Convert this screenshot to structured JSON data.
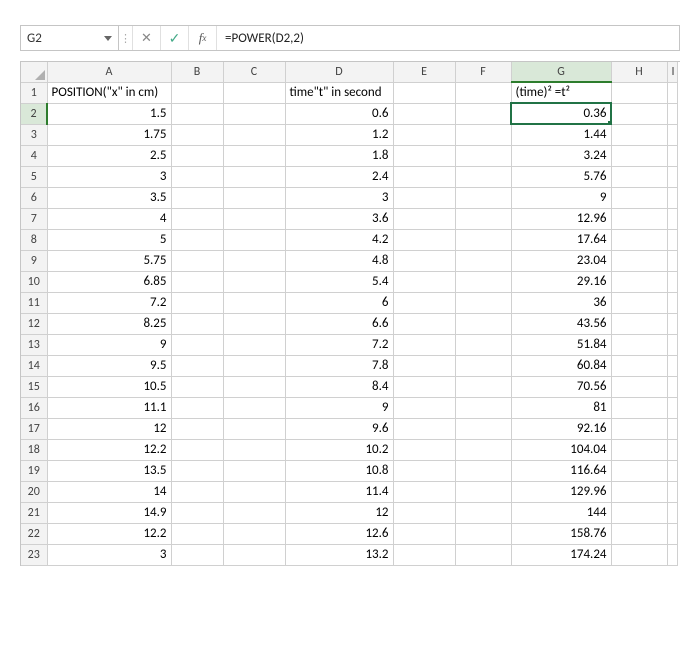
{
  "name_box": "G2",
  "formula": "=POWER(D2,2)",
  "columns": [
    "A",
    "B",
    "C",
    "D",
    "E",
    "F",
    "G",
    "H",
    "I"
  ],
  "active_cell": {
    "row": 2,
    "col": "G"
  },
  "headers": {
    "A": "POSITION(\"x\" in cm)",
    "D": "time\"t\" in second",
    "G": "(time)² =t²"
  },
  "chart_data": {
    "type": "table",
    "columns": [
      "POSITION(\"x\" in cm)",
      "time\"t\" in second",
      "(time)² =t²"
    ],
    "rows": [
      {
        "pos": "1.5",
        "time": "0.6",
        "t2": "0.36"
      },
      {
        "pos": "1.75",
        "time": "1.2",
        "t2": "1.44"
      },
      {
        "pos": "2.5",
        "time": "1.8",
        "t2": "3.24"
      },
      {
        "pos": "3",
        "time": "2.4",
        "t2": "5.76"
      },
      {
        "pos": "3.5",
        "time": "3",
        "t2": "9"
      },
      {
        "pos": "4",
        "time": "3.6",
        "t2": "12.96"
      },
      {
        "pos": "5",
        "time": "4.2",
        "t2": "17.64"
      },
      {
        "pos": "5.75",
        "time": "4.8",
        "t2": "23.04"
      },
      {
        "pos": "6.85",
        "time": "5.4",
        "t2": "29.16"
      },
      {
        "pos": "7.2",
        "time": "6",
        "t2": "36"
      },
      {
        "pos": "8.25",
        "time": "6.6",
        "t2": "43.56"
      },
      {
        "pos": "9",
        "time": "7.2",
        "t2": "51.84"
      },
      {
        "pos": "9.5",
        "time": "7.8",
        "t2": "60.84"
      },
      {
        "pos": "10.5",
        "time": "8.4",
        "t2": "70.56"
      },
      {
        "pos": "11.1",
        "time": "9",
        "t2": "81"
      },
      {
        "pos": "12",
        "time": "9.6",
        "t2": "92.16"
      },
      {
        "pos": "12.2",
        "time": "10.2",
        "t2": "104.04"
      },
      {
        "pos": "13.5",
        "time": "10.8",
        "t2": "116.64"
      },
      {
        "pos": "14",
        "time": "11.4",
        "t2": "129.96"
      },
      {
        "pos": "14.9",
        "time": "12",
        "t2": "144"
      },
      {
        "pos": "12.2",
        "time": "12.6",
        "t2": "158.76"
      },
      {
        "pos": "3",
        "time": "13.2",
        "t2": "174.24"
      }
    ]
  }
}
